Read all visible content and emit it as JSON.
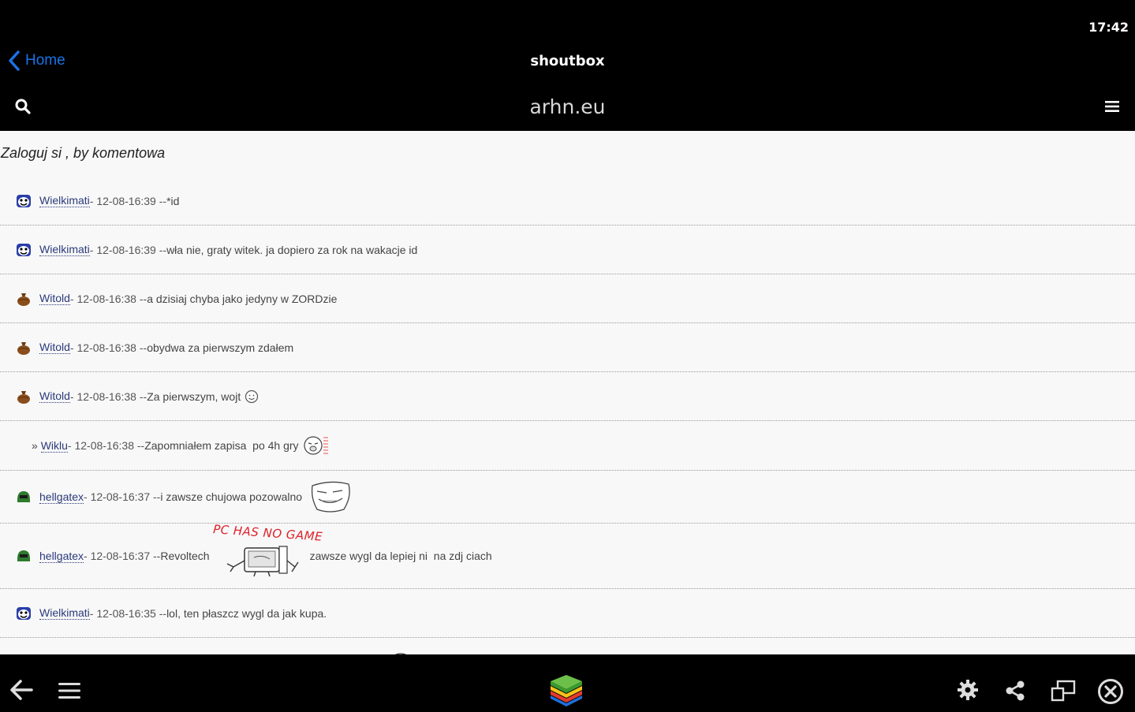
{
  "status": {
    "time": "17:42"
  },
  "nav": {
    "back_label": "Home",
    "title": "shoutbox"
  },
  "site": {
    "title": "arhn.eu"
  },
  "login_prompt": "Zaloguj si , by komentowa",
  "shouts": [
    {
      "user": "Wielkimati",
      "meta": " - 12-08-16:39 -- ",
      "text": "*id",
      "avatar": "ghost-avatar-icon"
    },
    {
      "user": "Wielkimati",
      "meta": " - 12-08-16:39 -- ",
      "text": "wła nie, graty witek. ja dopiero za rok na wakacje id",
      "avatar": "ghost-avatar-icon"
    },
    {
      "user": "Witold",
      "meta": " - 12-08-16:38 -- ",
      "text": "a dzisiaj chyba jako jedyny w ZORDzie",
      "avatar": "bag-avatar-icon"
    },
    {
      "user": "Witold",
      "meta": " - 12-08-16:38 -- ",
      "text": "obydwa za pierwszym zdałem",
      "avatar": "bag-avatar-icon"
    },
    {
      "user": "Witold",
      "meta": " - 12-08-16:38 -- ",
      "text": "Za pierwszym, wojt",
      "avatar": "bag-avatar-icon"
    },
    {
      "prefix": "» ",
      "user": "Wiklu",
      "meta": " - 12-08-16:38 -- ",
      "text": "Zapomniałem zapisa  po 4h gry"
    },
    {
      "user": "hellgatex",
      "meta": " - 12-08-16:37 -- ",
      "text": "i zawsze chujowa pozowalno",
      "avatar": "helmet-avatar-icon"
    },
    {
      "user": "hellgatex",
      "meta": " - 12-08-16:37 -- ",
      "text": "Revoltech",
      "text2": "zawsze wygl da lepiej ni  na zdj ciach",
      "meme_caption": "PC HAS NO GAME",
      "avatar": "helmet-avatar-icon"
    },
    {
      "user": "Wielkimati",
      "meta": " - 12-08-16:35 -- ",
      "text": "lol, ten płaszcz wygl da jak kupa.",
      "avatar": "ghost-avatar-icon"
    }
  ],
  "colors": {
    "link": "#1a73e8",
    "username": "#2a3a7a",
    "content_bg": "#f8f8f8"
  }
}
